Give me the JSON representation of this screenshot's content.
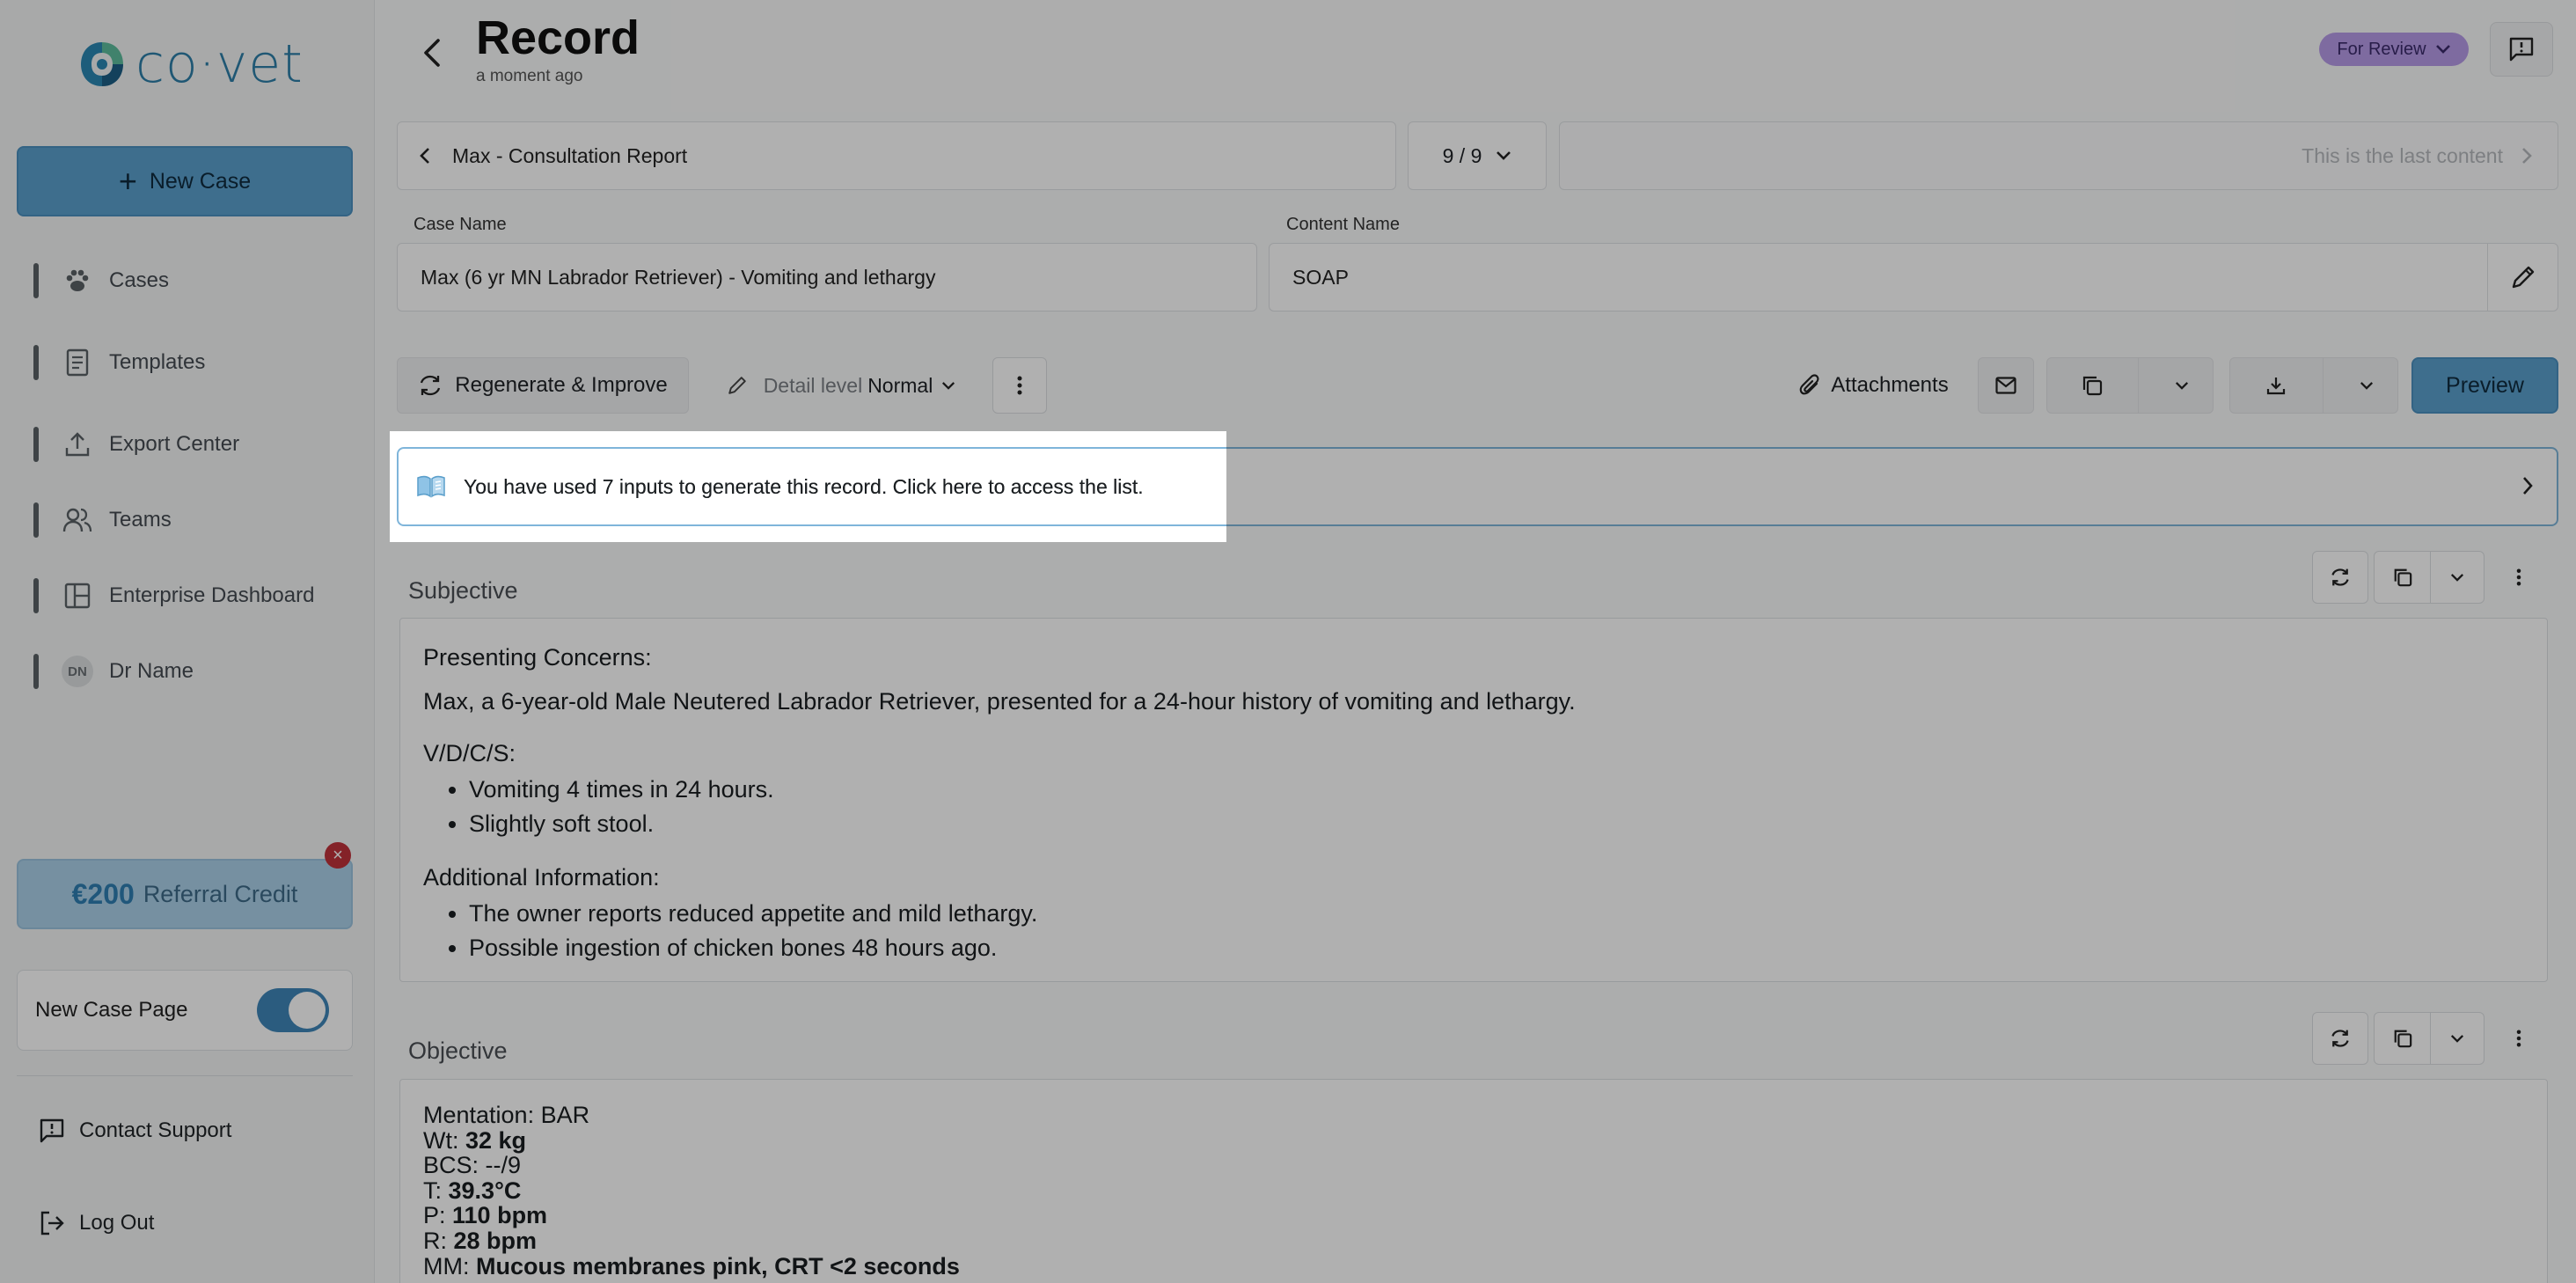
{
  "app": {
    "logo_text": "co·vet",
    "new_case_label": "New Case"
  },
  "sidebar": {
    "items": [
      {
        "label": "Cases",
        "icon": "paw-icon"
      },
      {
        "label": "Templates",
        "icon": "document-icon"
      },
      {
        "label": "Export Center",
        "icon": "upload-icon"
      },
      {
        "label": "Teams",
        "icon": "users-icon"
      },
      {
        "label": "Enterprise Dashboard",
        "icon": "dashboard-icon"
      },
      {
        "label": "Dr Name",
        "icon": "avatar-initials",
        "initials": "DN"
      }
    ],
    "referral": {
      "amount": "€200",
      "label": "Referral Credit"
    },
    "new_case_page": {
      "label": "New Case Page",
      "enabled": true
    },
    "contact_support": "Contact Support",
    "log_out": "Log Out"
  },
  "header": {
    "title": "Record",
    "subtitle": "a moment ago",
    "status": "For Review"
  },
  "nav": {
    "report_title": "Max - Consultation Report",
    "counter": "9 / 9",
    "next_label": "This is the last content"
  },
  "fields": {
    "case_name_label": "Case Name",
    "case_name_value": "Max (6 yr MN Labrador Retriever) - Vomiting and lethargy",
    "content_name_label": "Content Name",
    "content_name_value": "SOAP"
  },
  "toolbar": {
    "regenerate": "Regenerate & Improve",
    "detail_prefix": "Detail level",
    "detail_value": "Normal",
    "attachments": "Attachments",
    "preview": "Preview"
  },
  "banner": {
    "text": "You have used 7 inputs to generate this record. Click here to access the list."
  },
  "subjective": {
    "title": "Subjective",
    "presenting_heading": "Presenting Concerns:",
    "presenting_text": "Max, a 6-year-old Male Neutered Labrador Retriever, presented for a 24-hour history of vomiting and lethargy.",
    "vdcs_heading": "V/D/C/S:",
    "vdcs_items": [
      "Vomiting 4 times in 24 hours.",
      "Slightly soft stool."
    ],
    "additional_heading": "Additional Information:",
    "additional_items": [
      "The owner reports reduced appetite and mild lethargy.",
      "Possible ingestion of chicken bones 48 hours ago."
    ]
  },
  "objective": {
    "title": "Objective",
    "mentation": "Mentation: BAR",
    "lines": [
      {
        "label": "Wt: ",
        "value": "32 kg"
      },
      {
        "label": "BCS: ",
        "value": "",
        "plain": "--/9"
      },
      {
        "label": "T: ",
        "value": "39.3°C"
      },
      {
        "label": "P: ",
        "value": "110 bpm"
      },
      {
        "label": "R: ",
        "value": "28 bpm"
      },
      {
        "label": "MM: ",
        "value": "Mucous membranes pink, CRT <2 seconds"
      }
    ]
  },
  "colors": {
    "accent": "#5aa0cd",
    "status_pill": "#b79be8",
    "close_badge": "#c0323a"
  }
}
